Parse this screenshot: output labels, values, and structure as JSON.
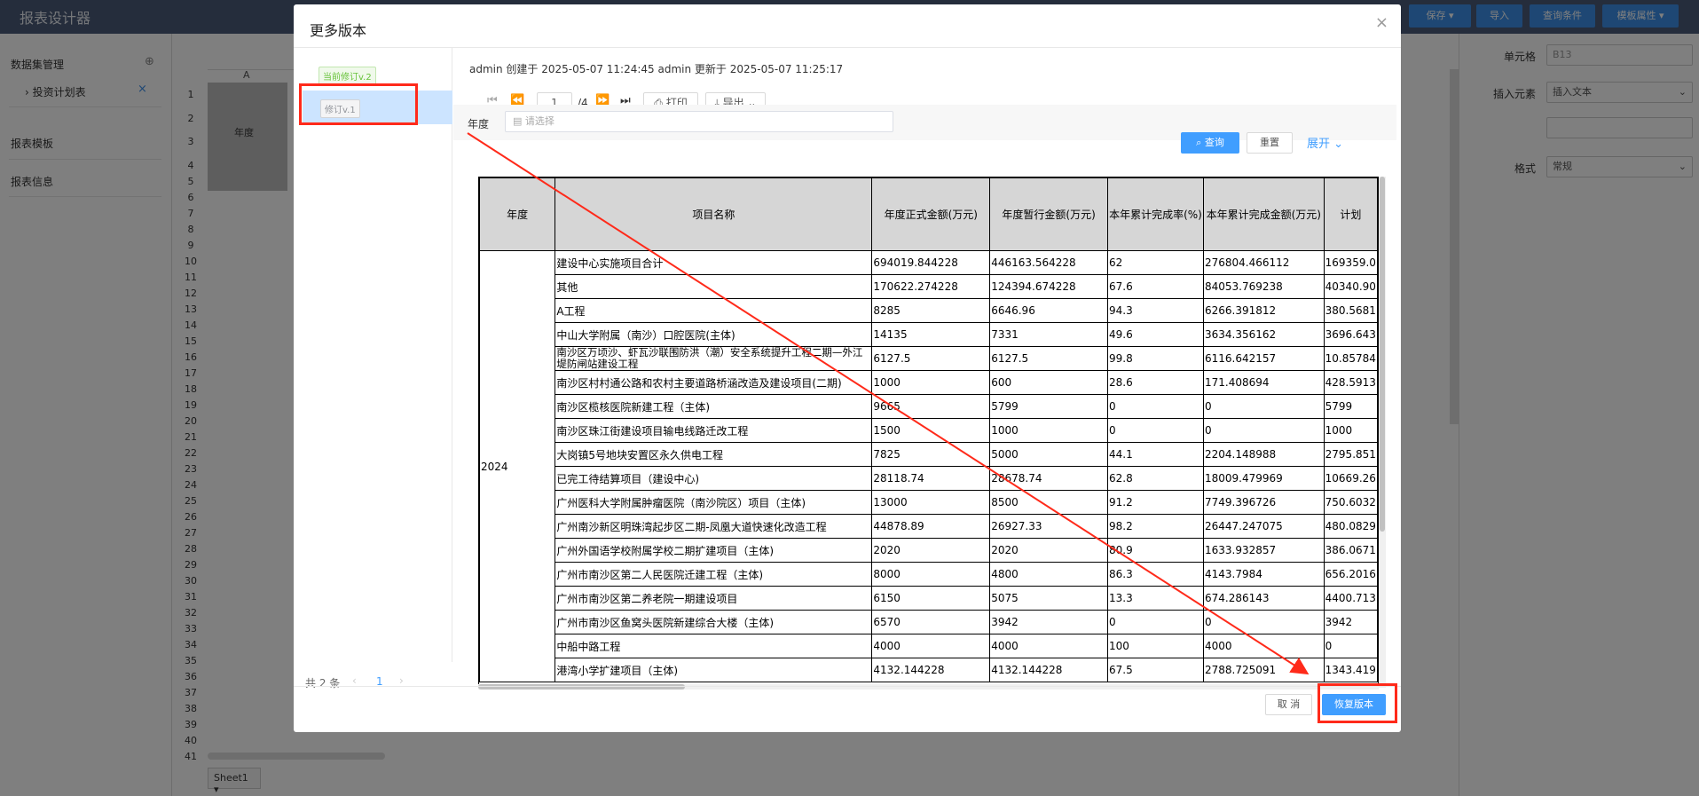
{
  "app": {
    "title": "报表设计器"
  },
  "topbar": {
    "buttons": [
      "保存",
      "导入",
      "查询条件",
      "模板属性"
    ]
  },
  "left_panel": {
    "dataset_title": "数据集管理",
    "dataset_item": "投资计划表",
    "report_template": "报表模板",
    "report_info": "报表信息"
  },
  "sheet": {
    "col_a": "A",
    "header_year": "年度",
    "rows": [
      "1",
      "2",
      "3",
      "4",
      "5",
      "6",
      "7",
      "8",
      "9",
      "10",
      "11",
      "12",
      "13",
      "14",
      "15",
      "16",
      "17",
      "18",
      "19",
      "20",
      "21",
      "22",
      "23",
      "24",
      "25",
      "26",
      "27",
      "28",
      "29",
      "30",
      "31",
      "32",
      "33",
      "34",
      "35",
      "36",
      "37",
      "38",
      "39",
      "40",
      "41"
    ],
    "tab": "Sheet1",
    "bg_cells": [
      "(%)",
      "计划"
    ]
  },
  "right_panel": {
    "cell_label": "单元格",
    "cell_value": "B13",
    "insert_label": "插入元素",
    "insert_value": "插入文本",
    "format_label": "格式",
    "format_value": "常规"
  },
  "modal": {
    "title": "更多版本",
    "close": "×",
    "versions": [
      {
        "label": "当前修订v.2"
      },
      {
        "label": "修订v.1"
      }
    ],
    "total": "共 2 条",
    "page": "1",
    "meta": "admin 创建于 2025-05-07 11:24:45 admin 更新于 2025-05-07 11:25:17",
    "pager": {
      "current": "1",
      "total": "/4"
    },
    "print_label": "打印",
    "export_label": "导出",
    "filter_label": "年度",
    "filter_placeholder": "请选择",
    "query_btn": "查询",
    "reset_btn": "重置",
    "expand_btn": "展开",
    "cancel_btn": "取 消",
    "restore_btn": "恢复版本"
  },
  "table": {
    "headers": [
      "年度",
      "项目名称",
      "年度正式金额(万元)",
      "年度暂行金额(万元)",
      "本年累计完成率(%)",
      "本年累计完成金额(万元)",
      "计划"
    ],
    "year": "2024",
    "rows": [
      [
        "建设中心实施项目合计",
        "694019.844228",
        "446163.564228",
        "62",
        "276804.466112",
        "169359.0"
      ],
      [
        "其他",
        "170622.274228",
        "124394.674228",
        "67.6",
        "84053.769238",
        "40340.90"
      ],
      [
        "A工程",
        "8285",
        "6646.96",
        "94.3",
        "6266.391812",
        "380.5681"
      ],
      [
        "中山大学附属（南沙）口腔医院(主体)",
        "14135",
        "7331",
        "49.6",
        "3634.356162",
        "3696.643"
      ],
      [
        "南沙区万顷沙、虾瓦沙联围防洪（潮）安全系统提升工程二期—外江堤防闸站建设工程",
        "6127.5",
        "6127.5",
        "99.8",
        "6116.642157",
        "10.85784"
      ],
      [
        "南沙区村村通公路和农村主要道路桥涵改造及建设项目(二期)",
        "1000",
        "600",
        "28.6",
        "171.408694",
        "428.5913"
      ],
      [
        "南沙区榄核医院新建工程（主体)",
        "9665",
        "5799",
        "0",
        "0",
        "5799"
      ],
      [
        "南沙区珠江街建设项目输电线路迁改工程",
        "1500",
        "1000",
        "0",
        "0",
        "1000"
      ],
      [
        "大岗镇5号地块安置区永久供电工程",
        "7825",
        "5000",
        "44.1",
        "2204.148988",
        "2795.851"
      ],
      [
        "已完工待结算项目（建设中心)",
        "28118.74",
        "28678.74",
        "62.8",
        "18009.479969",
        "10669.26"
      ],
      [
        "广州医科大学附属肿瘤医院（南沙院区）项目（主体)",
        "13000",
        "8500",
        "91.2",
        "7749.396726",
        "750.6032"
      ],
      [
        "广州南沙新区明珠湾起步区二期-凤凰大道快速化改造工程",
        "44878.89",
        "26927.33",
        "98.2",
        "26447.247075",
        "480.0829"
      ],
      [
        "广州外国语学校附属学校二期扩建项目（主体)",
        "2020",
        "2020",
        "80.9",
        "1633.932857",
        "386.0671"
      ],
      [
        "广州市南沙区第二人民医院迁建工程（主体)",
        "8000",
        "4800",
        "86.3",
        "4143.7984",
        "656.2016"
      ],
      [
        "广州市南沙区第二养老院一期建设项目",
        "6150",
        "5075",
        "13.3",
        "674.286143",
        "4400.713"
      ],
      [
        "广州市南沙区鱼窝头医院新建综合大楼（主体)",
        "6570",
        "3942",
        "0",
        "0",
        "3942"
      ],
      [
        "中船中路工程",
        "4000",
        "4000",
        "100",
        "4000",
        "0"
      ],
      [
        "港湾小学扩建项目（主体)",
        "4132.144228",
        "4132.144228",
        "67.5",
        "2788.725091",
        "1343.419"
      ]
    ]
  },
  "colors": {
    "accent": "#409eff",
    "annotation": "#ff2a1a",
    "topbar": "#4a5a78"
  }
}
